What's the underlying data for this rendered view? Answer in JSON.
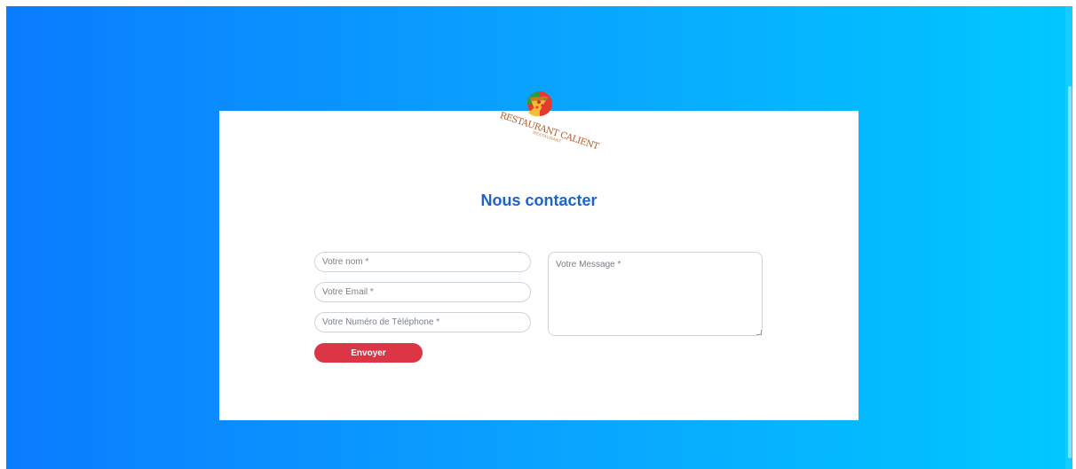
{
  "colors": {
    "background_gradient_start": "#0a7cff",
    "background_gradient_end": "#00c8ff",
    "title": "#1e64c8",
    "submit_button": "#dc3545"
  },
  "logo": {
    "text": "RESTAURANT CALIENT",
    "subtext": "RESTAURANT",
    "icon": "pizza-icon"
  },
  "contact": {
    "title": "Nous contacter",
    "name_placeholder": "Votre nom *",
    "email_placeholder": "Votre Email *",
    "phone_placeholder": "Votre Numéro de Téléphone *",
    "message_placeholder": "Votre Message *",
    "submit_label": "Envoyer"
  }
}
